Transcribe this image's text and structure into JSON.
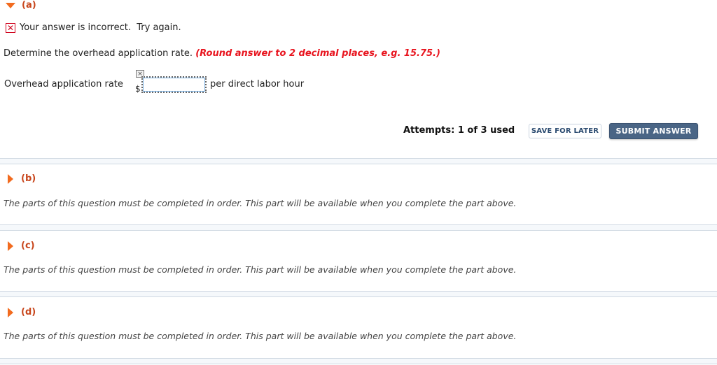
{
  "parts": [
    {
      "label": "(a)",
      "state": "expanded"
    },
    {
      "label": "(b)",
      "state": "collapsed",
      "message": "The parts of this question must be completed in order. This part will be available when you complete the part above."
    },
    {
      "label": "(c)",
      "state": "collapsed",
      "message": "The parts of this question must be completed in order. This part will be available when you complete the part above."
    },
    {
      "label": "(d)",
      "state": "collapsed",
      "message": "The parts of this question must be completed in order. This part will be available when you complete the part above."
    }
  ],
  "feedback": {
    "icon": "incorrect-x-icon",
    "text": "Your answer is incorrect.  Try again."
  },
  "question": {
    "text": "Determine the overhead application rate. ",
    "hint": "(Round answer to 2 decimal places, e.g. 15.75.)"
  },
  "answer_row": {
    "label": "Overhead application rate",
    "currency": "$",
    "value": "",
    "mark": "×",
    "unit": "per direct labor hour"
  },
  "attempts": "Attempts: 1 of 3 used",
  "buttons": {
    "save": "SAVE FOR LATER",
    "submit": "SUBMIT ANSWER"
  },
  "colors": {
    "accent_orange": "#f26b1f",
    "part_label": "#c8461c",
    "error_red": "#e8141e",
    "submit_bg": "#4a6585"
  }
}
